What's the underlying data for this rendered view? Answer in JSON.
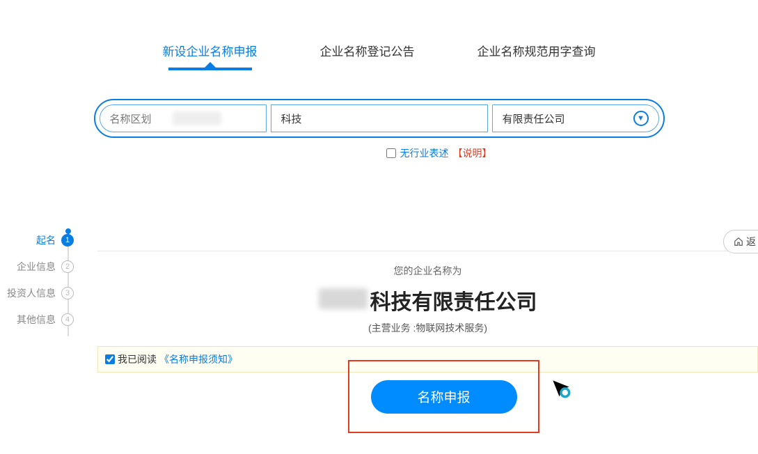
{
  "tabs": [
    {
      "label": "新设企业名称申报",
      "active": true
    },
    {
      "label": "企业名称登记公告",
      "active": false
    },
    {
      "label": "企业名称规范用字查询",
      "active": false
    }
  ],
  "search": {
    "region_placeholder": "名称区划",
    "industry_value": "科技",
    "type_value": "有限责任公司"
  },
  "no_industry": {
    "label": "无行业表述",
    "explain": "【说明】"
  },
  "steps": [
    {
      "label": "起名",
      "num": "1",
      "active": true
    },
    {
      "label": "企业信息",
      "num": "2",
      "active": false
    },
    {
      "label": "投资人信息",
      "num": "3",
      "active": false
    },
    {
      "label": "其他信息",
      "num": "4",
      "active": false
    }
  ],
  "panel": {
    "hint": "您的企业名称为",
    "name_suffix": "科技有限责任公司",
    "biz": "(主营业务 :物联网技术服务)"
  },
  "agree": {
    "prefix": "我已阅读",
    "link": "《名称申报须知》"
  },
  "submit_label": "名称申报",
  "back_label": "返"
}
